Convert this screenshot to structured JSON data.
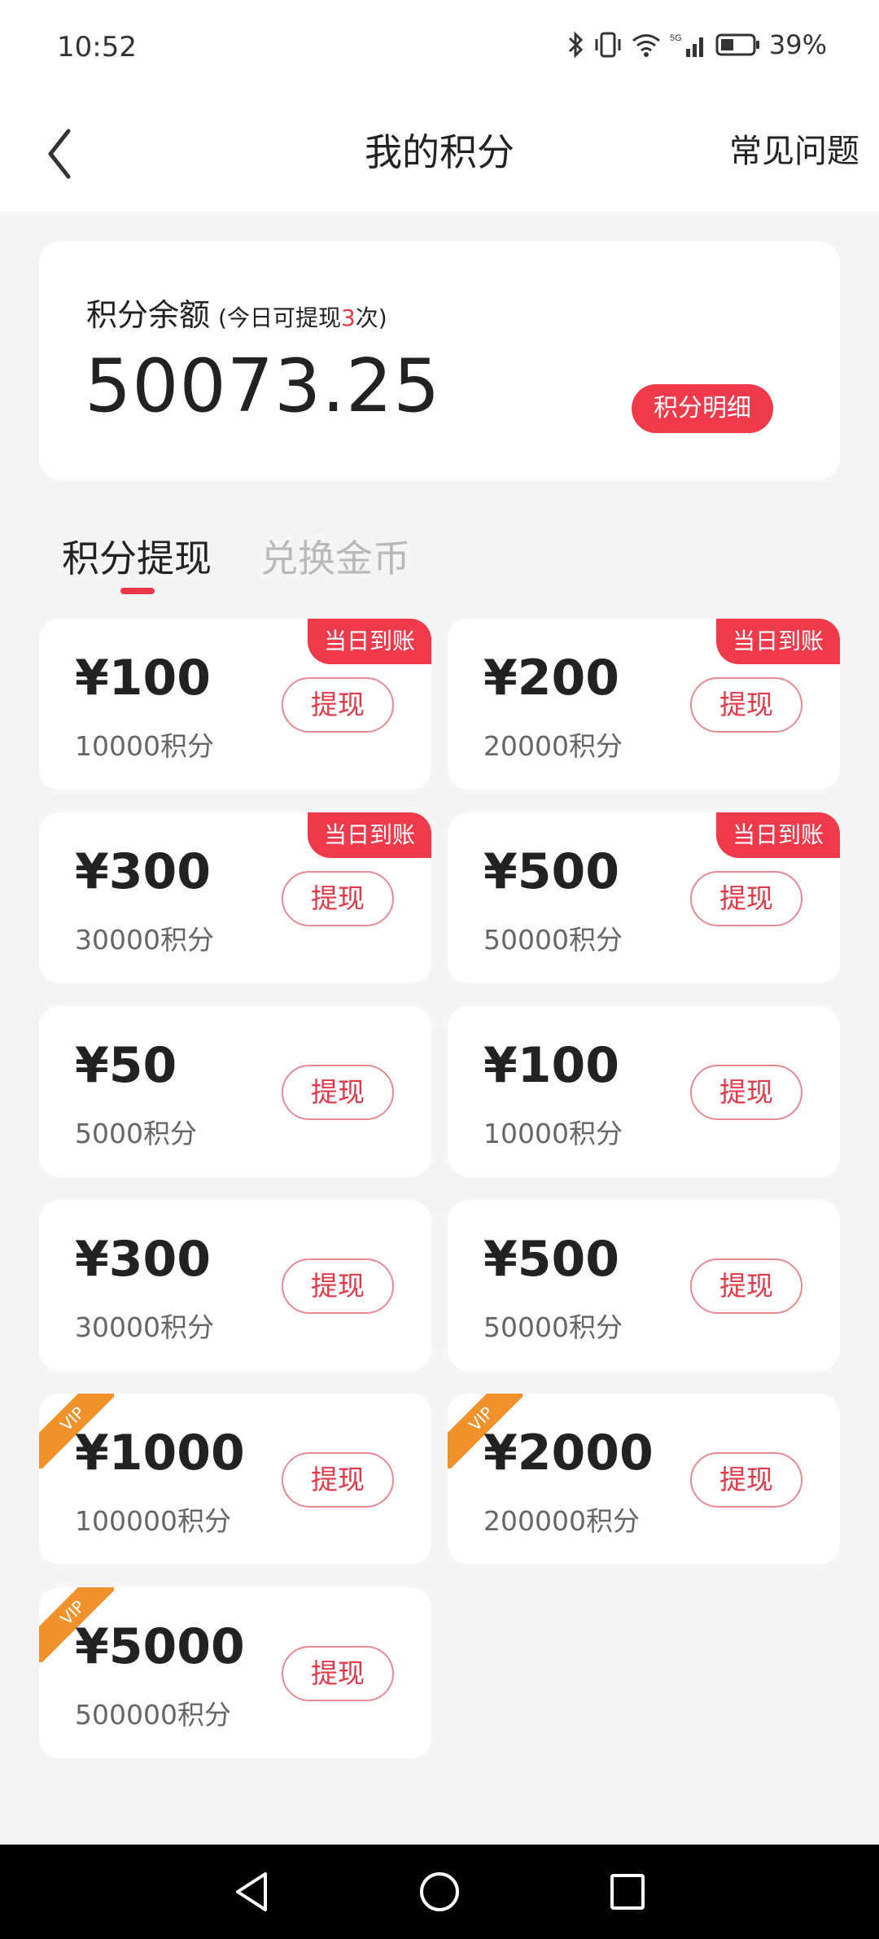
{
  "status": {
    "time": "10:52",
    "battery": "39%"
  },
  "header": {
    "title": "我的积分",
    "faq": "常见问题"
  },
  "balance": {
    "label": "积分余额",
    "note_prefix": "(今日可提现",
    "note_count": "3",
    "note_suffix": "次)",
    "amount": "50073.25",
    "detail_button": "积分明细"
  },
  "tabs": [
    {
      "label": "积分提现",
      "active": true
    },
    {
      "label": "兑换金币",
      "active": false
    }
  ],
  "items": [
    {
      "price": "¥100",
      "points": "10000积分",
      "button": "提现",
      "badge": "当日到账"
    },
    {
      "price": "¥200",
      "points": "20000积分",
      "button": "提现",
      "badge": "当日到账"
    },
    {
      "price": "¥300",
      "points": "30000积分",
      "button": "提现",
      "badge": "当日到账"
    },
    {
      "price": "¥500",
      "points": "50000积分",
      "button": "提现",
      "badge": "当日到账"
    },
    {
      "price": "¥50",
      "points": "5000积分",
      "button": "提现"
    },
    {
      "price": "¥100",
      "points": "10000积分",
      "button": "提现"
    },
    {
      "price": "¥300",
      "points": "30000积分",
      "button": "提现"
    },
    {
      "price": "¥500",
      "points": "50000积分",
      "button": "提现"
    },
    {
      "price": "¥1000",
      "points": "100000积分",
      "button": "提现",
      "vip": "VIP"
    },
    {
      "price": "¥2000",
      "points": "200000积分",
      "button": "提现",
      "vip": "VIP"
    },
    {
      "price": "¥5000",
      "points": "500000积分",
      "button": "提现",
      "vip": "VIP"
    }
  ],
  "colors": {
    "accent": "#ef3a4b",
    "vip": "#f0922b",
    "background": "#f5f5f5"
  }
}
